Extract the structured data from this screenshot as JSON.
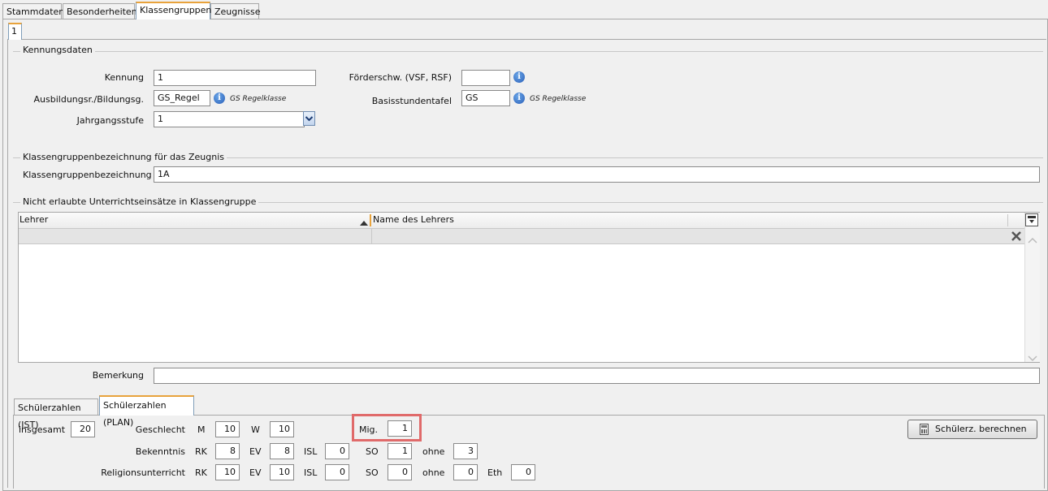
{
  "tabs_top": [
    "Stammdaten",
    "Besonderheiten",
    "Klassengruppen",
    "Zeugnisse"
  ],
  "subtab": "1",
  "kennungsdaten": {
    "legend": "Kennungsdaten",
    "kennung_label": "Kennung",
    "kennung_value": "1",
    "ausbildung_label": "Ausbildungsr./Bildungsg.",
    "ausbildung_value": "GS_Regel",
    "ausbildung_note": "GS Regelklasse",
    "jahrgang_label": "Jahrgangsstufe",
    "jahrgang_value": "1",
    "foerder_label": "Förderschw. (VSF, RSF)",
    "foerder_value": "",
    "basis_label": "Basisstundentafel",
    "basis_value": "GS",
    "basis_note": "GS Regelklasse"
  },
  "bezeichnung": {
    "legend": "Klassengruppenbezeichnung für das Zeugnis",
    "label": "Klassengruppenbezeichnung",
    "value": "1A"
  },
  "nicht_erlaubt": {
    "legend": "Nicht erlaubte Unterrichtseinsätze in Klassengruppe",
    "col_lehrer": "Lehrer",
    "col_name": "Name des Lehrers"
  },
  "bemerkung": {
    "label": "Bemerkung",
    "value": ""
  },
  "schueler_tabs": [
    "Schülerzahlen (IST)",
    "Schülerzahlen (PLAN)"
  ],
  "schueler": {
    "insgesamt_label": "insgesamt",
    "insgesamt": "20",
    "geschlecht_label": "Geschlecht",
    "m_label": "M",
    "m": "10",
    "w_label": "W",
    "w": "10",
    "mig_label": "Mig.",
    "mig": "1",
    "bekenntnis_label": "Bekenntnis",
    "bek_rk_label": "RK",
    "bek_rk": "8",
    "bek_ev_label": "EV",
    "bek_ev": "8",
    "bek_isl_label": "ISL",
    "bek_isl": "0",
    "bek_so_label": "SO",
    "bek_so": "1",
    "bek_ohne_label": "ohne",
    "bek_ohne": "3",
    "religion_label": "Religionsunterricht",
    "rel_rk_label": "RK",
    "rel_rk": "10",
    "rel_ev_label": "EV",
    "rel_ev": "10",
    "rel_isl_label": "ISL",
    "rel_isl": "0",
    "rel_so_label": "SO",
    "rel_so": "0",
    "rel_ohne_label": "ohne",
    "rel_ohne": "0",
    "rel_eth_label": "Eth",
    "rel_eth": "0",
    "berechnen_label": "Schülerz. berechnen"
  },
  "colors": {
    "highlight": "#e06a6a",
    "tab_accent": "#e8a33c",
    "info": "#2a5fb8"
  },
  "icons": [
    "info-icon",
    "dropdown-arrow-icon",
    "sort-ascending-icon",
    "column-chooser-icon",
    "clear-filter-icon",
    "calculator-icon"
  ]
}
